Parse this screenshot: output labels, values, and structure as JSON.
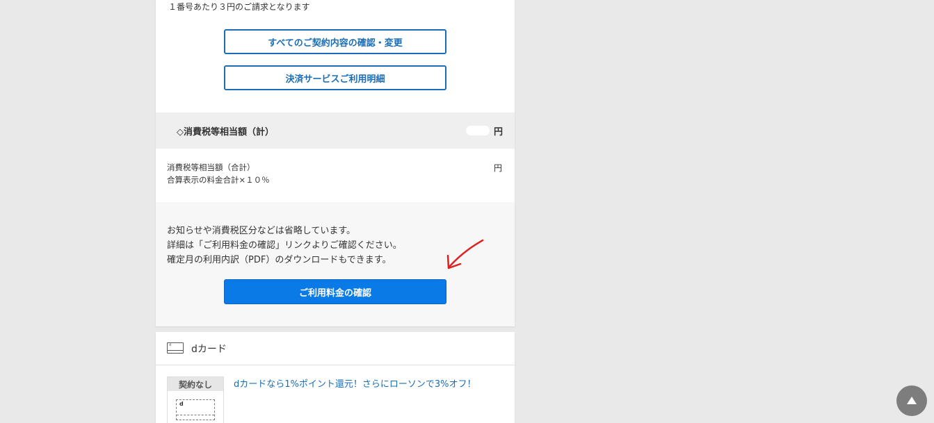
{
  "billing": {
    "note_top": "１番号あたり３円のご請求となります",
    "contract_button": "すべてのご契約内容の確認・変更",
    "payment_button": "決済サービスご利用明細"
  },
  "tax": {
    "title": "◇消費税等相当額（計）",
    "unit": "円",
    "detail_line1": "消費税等相当額（合計）",
    "detail_line2": "合算表示の料金合計×１０％",
    "detail_unit": "円"
  },
  "info": {
    "line1": "お知らせや消費税区分などは省略しています。",
    "line2": "詳細は「ご利用料金の確認」リンクよりご確認ください。",
    "line3": "確定月の利用内訳（PDF）のダウンロードもできます。",
    "confirm_button": "ご利用料金の確認"
  },
  "dcard": {
    "title": "dカード",
    "icon_letter": "d",
    "thumb_label": "契約なし",
    "thumb_card_letter": "d",
    "promo_link": "dカードなら1%ポイント還元！さらにローソンで3%オフ！"
  },
  "icons": {
    "annotation": "red-arrow-icon",
    "scroll_top": "arrow-up-icon",
    "card": "credit-card-icon"
  },
  "colors": {
    "primary": "#0a7ae6",
    "link": "#1a6db5",
    "annotation": "#e02020"
  }
}
